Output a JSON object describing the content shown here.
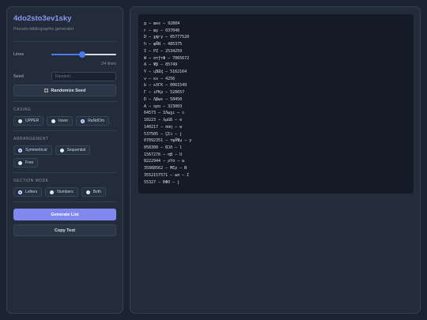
{
  "app": {
    "title": "4do2sto3ev1sky",
    "subtitle": "Pseudo-bibliographic generator"
  },
  "lines": {
    "label": "Lines",
    "value": 24,
    "fraction": 0.47,
    "count_text": "24 lines"
  },
  "seed": {
    "label": "Seed",
    "placeholder": "Random...",
    "value": "",
    "randomize_label": "Randomize Seed",
    "randomize_icon": "dice-icon"
  },
  "casing": {
    "label": "CASING",
    "options": [
      "UPPER",
      "lower",
      "RaNdOm"
    ],
    "selected": "RaNdOm"
  },
  "arrangement": {
    "label": "ARRANGEMENT",
    "options": [
      "Symmetrical",
      "Sequential",
      "Free"
    ],
    "selected": "Symmetrical"
  },
  "section_mode": {
    "label": "SECTION MODE",
    "options": [
      "Letters",
      "Numbers",
      "Both"
    ],
    "selected": "Letters"
  },
  "actions": {
    "generate_label": "Generate List",
    "copy_label": "Copy Text"
  },
  "colors": {
    "accent": "#8189ee",
    "radio_selected": "#4a7cf0",
    "background": "#1c2431",
    "panel": "#222c3b",
    "output_bg": "#141b27"
  },
  "output_lines": [
    "д — шнх — 92804",
    "г — шу — 037046",
    "D — ɣɱгγ — 05777520",
    "h — φÅN — 485375",
    "I — PZ — 2534259",
    "W — στƒτΦ — 7065672",
    "A — Ψβ — 85749",
    "Y — ɥƁƵɖ — 5162164",
    "v — кν — 4256",
    "b — εΛΓК — 0061549",
    "Γ — ıPKρ — 520657",
    "D — Λβωε — 58450",
    "A — ορυ — 323003",
    "64573 — ΙΛωɣı — c",
    "10223 — λμGƂ — e",
    "140217 — σση — w",
    "537505 — ÇƐɔ — j",
    "07092351 — τψÄΨμ — y",
    "058300 — ΒƆΛ — l",
    "1567276 — πβ — U",
    "8222944 — ρYσ — w",
    "35988562 — ΜƐρ — N",
    "3552157571 — ωσ — I",
    "55327 — ĐΦΟ — j"
  ]
}
